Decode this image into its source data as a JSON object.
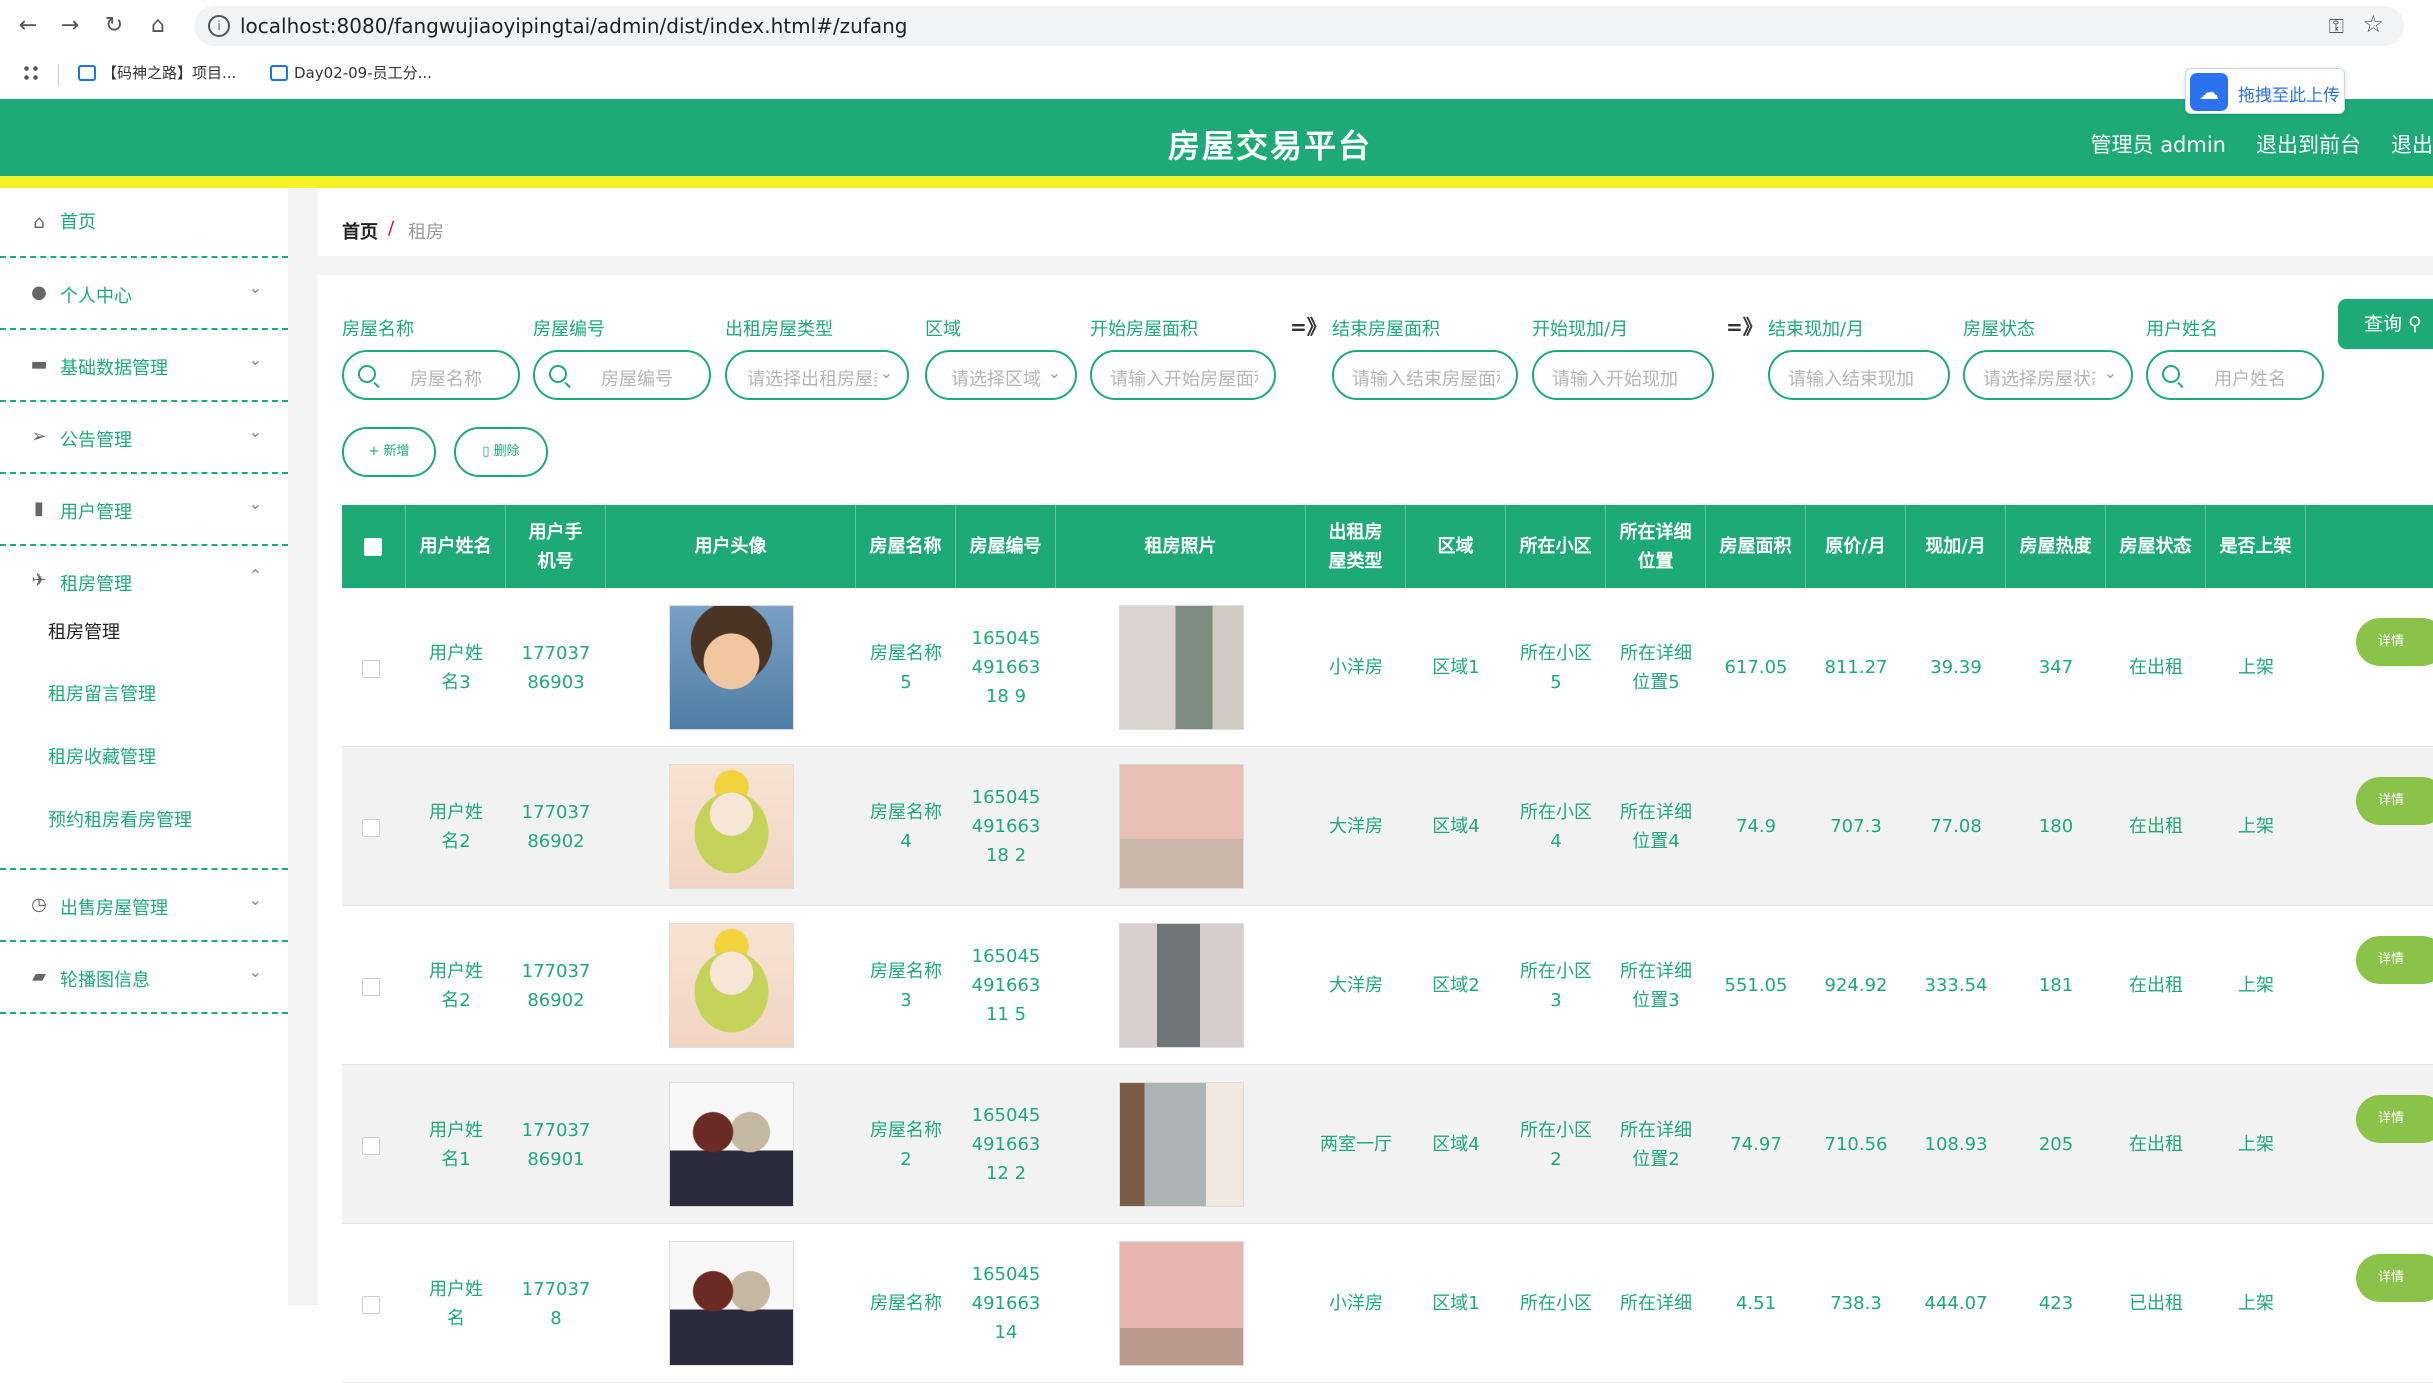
{
  "browser": {
    "url": "localhost:8080/fangwujiaoyipingtai/admin/dist/index.html#/zufang",
    "bookmarks": [
      "【码神之路】项目...",
      "Day02-09-员工分..."
    ],
    "upload_button": "拖拽至此上传"
  },
  "header": {
    "title": "房屋交易平台",
    "links": [
      "管理员 admin",
      "退出到前台",
      "退出"
    ],
    "colors": {
      "primary": "#1eaa77",
      "stripe": "#f2f227"
    }
  },
  "sidebar": {
    "items": [
      {
        "label": "首页",
        "icon": "home-icon"
      },
      {
        "label": "个人中心",
        "icon": "user-icon"
      },
      {
        "label": "基础数据管理",
        "icon": "briefcase-icon"
      },
      {
        "label": "公告管理",
        "icon": "send-icon"
      },
      {
        "label": "用户管理",
        "icon": "bar-chart-icon"
      },
      {
        "label": "租房管理",
        "icon": "paper-plane-icon"
      },
      {
        "label": "出售房屋管理",
        "icon": "compass-icon"
      },
      {
        "label": "轮播图信息",
        "icon": "wallet-icon"
      }
    ],
    "sub_items": [
      "租房管理",
      "租房留言管理",
      "租房收藏管理",
      "预约租房看房管理"
    ]
  },
  "breadcrumb": {
    "home": "首页",
    "separator": "/",
    "current": "租房"
  },
  "filters": {
    "labels": [
      "房屋名称",
      "房屋编号",
      "出租房屋类型",
      "区域",
      "开始房屋面积",
      "结束房屋面积",
      "开始现加/月",
      "结束现加/月",
      "房屋状态",
      "用户姓名"
    ],
    "placeholders": [
      "房屋名称",
      "房屋编号",
      "请选择出租房屋类型",
      "请选择区域",
      "请输入开始房屋面积",
      "请输入结束房屋面积",
      "请输入开始现加",
      "请输入结束现加",
      "请选择房屋状态",
      "用户姓名"
    ],
    "arrow": "=》",
    "query_button": "查询",
    "add_button": "新增",
    "delete_button": "删除"
  },
  "table": {
    "columns": [
      "用户姓名",
      "用户手机号",
      "用户头像",
      "房屋名称",
      "房屋编号",
      "租房照片",
      "出租房屋类型",
      "区域",
      "所在小区",
      "所在详细位置",
      "房屋面积",
      "原价/月",
      "现加/月",
      "房屋热度",
      "房屋状态",
      "是否上架"
    ],
    "detail_button": "详情",
    "rows": [
      {
        "name": "用户姓名3",
        "phone": "17703786903",
        "avatar": "boy",
        "house": "房屋名称5",
        "code": "16504549166318 9",
        "photo": "room1",
        "type": "小洋房",
        "area": "区域1",
        "community": "所在小区5",
        "location": "所在详细位置5",
        "size": "617.05",
        "orig": "811.27",
        "now": "39.39",
        "heat": "347",
        "status": "在出租",
        "shelf": "上架"
      },
      {
        "name": "用户姓名2",
        "phone": "17703786902",
        "avatar": "girl",
        "house": "房屋名称4",
        "code": "16504549166318 2",
        "photo": "room2",
        "type": "大洋房",
        "area": "区域4",
        "community": "所在小区4",
        "location": "所在详细位置4",
        "size": "74.9",
        "orig": "707.3",
        "now": "77.08",
        "heat": "180",
        "status": "在出租",
        "shelf": "上架"
      },
      {
        "name": "用户姓名2",
        "phone": "17703786902",
        "avatar": "girl",
        "house": "房屋名称3",
        "code": "16504549166311 5",
        "photo": "room3",
        "type": "大洋房",
        "area": "区域2",
        "community": "所在小区3",
        "location": "所在详细位置3",
        "size": "551.05",
        "orig": "924.92",
        "now": "333.54",
        "heat": "181",
        "status": "在出租",
        "shelf": "上架"
      },
      {
        "name": "用户姓名1",
        "phone": "17703786901",
        "avatar": "two",
        "house": "房屋名称2",
        "code": "16504549166312 2",
        "photo": "room4",
        "type": "两室一厅",
        "area": "区域4",
        "community": "所在小区2",
        "location": "所在详细位置2",
        "size": "74.97",
        "orig": "710.56",
        "now": "108.93",
        "heat": "205",
        "status": "在出租",
        "shelf": "上架"
      },
      {
        "name": "用户姓名",
        "phone": "1770378",
        "avatar": "two",
        "house": "房屋名称",
        "code": "16504549166314",
        "photo": "room5",
        "type": "小洋房",
        "area": "区域1",
        "community": "所在小区",
        "location": "所在详细",
        "size": "4.51",
        "orig": "738.3",
        "now": "444.07",
        "heat": "423",
        "status": "已出租",
        "shelf": "上架"
      }
    ]
  }
}
